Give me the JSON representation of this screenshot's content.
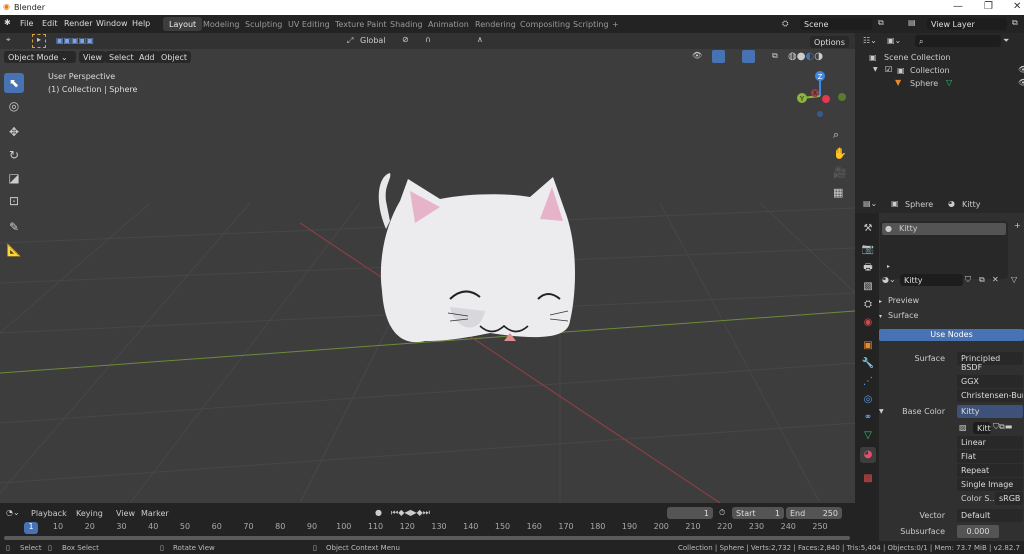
{
  "window": {
    "title": "Blender",
    "minimize": "—",
    "restore": "❐",
    "close": "✕"
  },
  "menus": [
    "File",
    "Edit",
    "Render",
    "Window",
    "Help"
  ],
  "workspaces": [
    "Layout",
    "Modeling",
    "Sculpting",
    "UV Editing",
    "Texture Paint",
    "Shading",
    "Animation",
    "Rendering",
    "Compositing",
    "Scripting",
    "+"
  ],
  "scene": {
    "name": "Scene",
    "view_layer": "View Layer"
  },
  "tool_header": {
    "orientation": "Global"
  },
  "viewport_header": {
    "mode": "Object Mode",
    "items": [
      "View",
      "Select",
      "Add",
      "Object"
    ],
    "options": "Options"
  },
  "viewport": {
    "perspective": "User Perspective",
    "context": "(1) Collection | Sphere",
    "gizmo": {
      "z": "Z",
      "y": "Y",
      "x": "X"
    }
  },
  "outliner": {
    "search_placeholder": "",
    "root": "Scene Collection",
    "collection": "Collection",
    "object": "Sphere"
  },
  "properties": {
    "object": "Sphere",
    "material": "Kitty",
    "slot": "Kitty",
    "material_field": "Kitty",
    "preview": "Preview",
    "surface_panel": "Surface",
    "use_nodes": "Use Nodes",
    "rows": {
      "surface_label": "Surface",
      "surface_value": "Principled BSDF",
      "distribution": "GGX",
      "subsurface_method": "Christensen-Burle",
      "base_color_label": "Base Color",
      "base_color_value": "Kitty",
      "image_name": "Kitt",
      "interpolation": "Linear",
      "projection": "Flat",
      "extension": "Repeat",
      "source": "Single Image",
      "color_space_label": "Color S..",
      "color_space": "sRGB",
      "vector_label": "Vector",
      "vector_value": "Default",
      "subsurface_label": "Subsurface",
      "subsurface_value": "0.000"
    }
  },
  "timeline": {
    "menus": [
      "Playback",
      "Keying",
      "View",
      "Marker"
    ],
    "current_frame": "1",
    "start_label": "Start",
    "start": "1",
    "end_label": "End",
    "end": "250",
    "ticks": [
      "10",
      "20",
      "30",
      "40",
      "50",
      "60",
      "70",
      "80",
      "90",
      "100",
      "110",
      "120",
      "130",
      "140",
      "150",
      "160",
      "170",
      "180",
      "190",
      "200",
      "210",
      "220",
      "230",
      "240",
      "250"
    ],
    "playhead": "1"
  },
  "status": {
    "select": "Select",
    "box_select": "Box Select",
    "rotate": "Rotate View",
    "context_menu": "Object Context Menu",
    "stats": "Collection | Sphere | Verts:2,732 | Faces:2,840 | Tris:5,404 | Objects:0/1 | Mem: 73.7 MiB | v2.82.7"
  },
  "colors": {
    "accent": "#4772b3",
    "viewport_bg": "#3d3d3d",
    "x_axis": "#c9444f",
    "y_axis": "#8cb63c",
    "z_axis": "#3c8ae6"
  }
}
